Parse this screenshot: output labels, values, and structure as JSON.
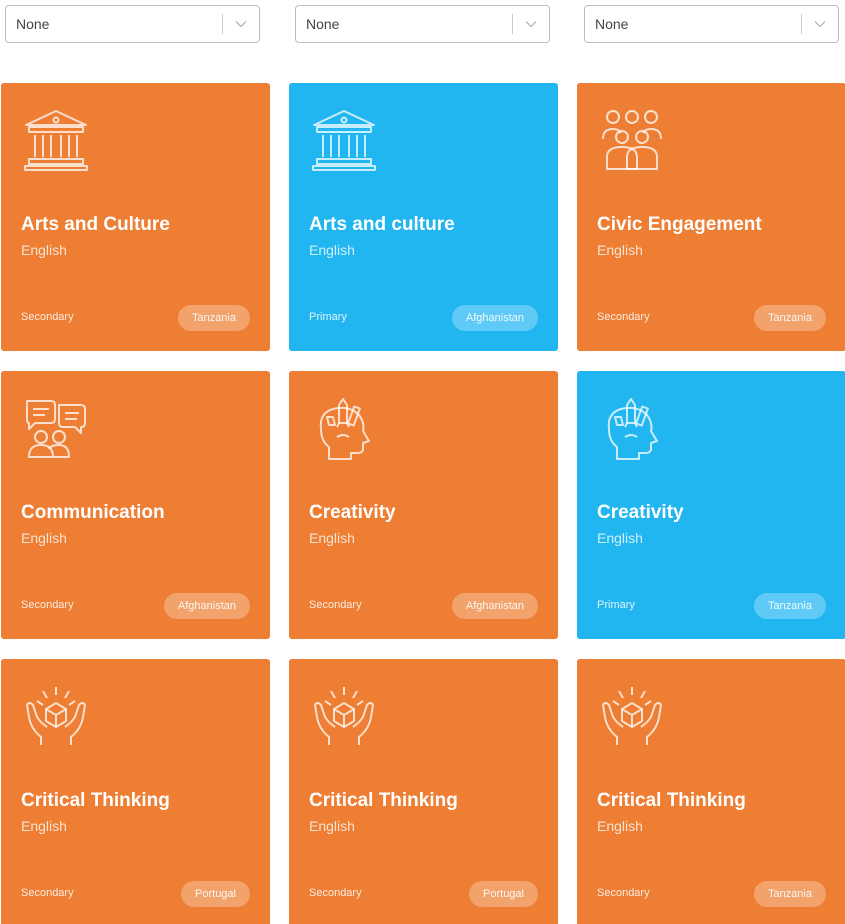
{
  "colors": {
    "orange": "#ED7E33",
    "blue": "#22B6F1"
  },
  "filters": [
    {
      "value": "None",
      "icon": "chevron-down-icon"
    },
    {
      "value": "None",
      "icon": "chevron-down-icon"
    },
    {
      "value": "None",
      "icon": "chevron-down-icon"
    }
  ],
  "cards": [
    {
      "title": "Arts and Culture",
      "language": "English",
      "level": "Secondary",
      "country": "Tanzania",
      "color": "#ED7E33",
      "icon": "museum-icon"
    },
    {
      "title": "Arts and culture",
      "language": "English",
      "level": "Primary",
      "country": "Afghanistan",
      "color": "#22B6F1",
      "icon": "museum-icon"
    },
    {
      "title": "Civic Engagement",
      "language": "English",
      "level": "Secondary",
      "country": "Tanzania",
      "color": "#ED7E33",
      "icon": "people-group-icon"
    },
    {
      "title": "Communication",
      "language": "English",
      "level": "Secondary",
      "country": "Afghanistan",
      "color": "#ED7E33",
      "icon": "speech-bubbles-icon"
    },
    {
      "title": "Creativity",
      "language": "English",
      "level": "Secondary",
      "country": "Afghanistan",
      "color": "#ED7E33",
      "icon": "creative-head-icon"
    },
    {
      "title": "Creativity",
      "language": "English",
      "level": "Primary",
      "country": "Tanzania",
      "color": "#22B6F1",
      "icon": "creative-head-icon"
    },
    {
      "title": "Critical Thinking",
      "language": "English",
      "level": "Secondary",
      "country": "Portugal",
      "color": "#ED7E33",
      "icon": "hands-gem-icon"
    },
    {
      "title": "Critical Thinking",
      "language": "English",
      "level": "Secondary",
      "country": "Portugal",
      "color": "#ED7E33",
      "icon": "hands-gem-icon"
    },
    {
      "title": "Critical Thinking",
      "language": "English",
      "level": "Secondary",
      "country": "Tanzania",
      "color": "#ED7E33",
      "icon": "hands-gem-icon"
    }
  ]
}
